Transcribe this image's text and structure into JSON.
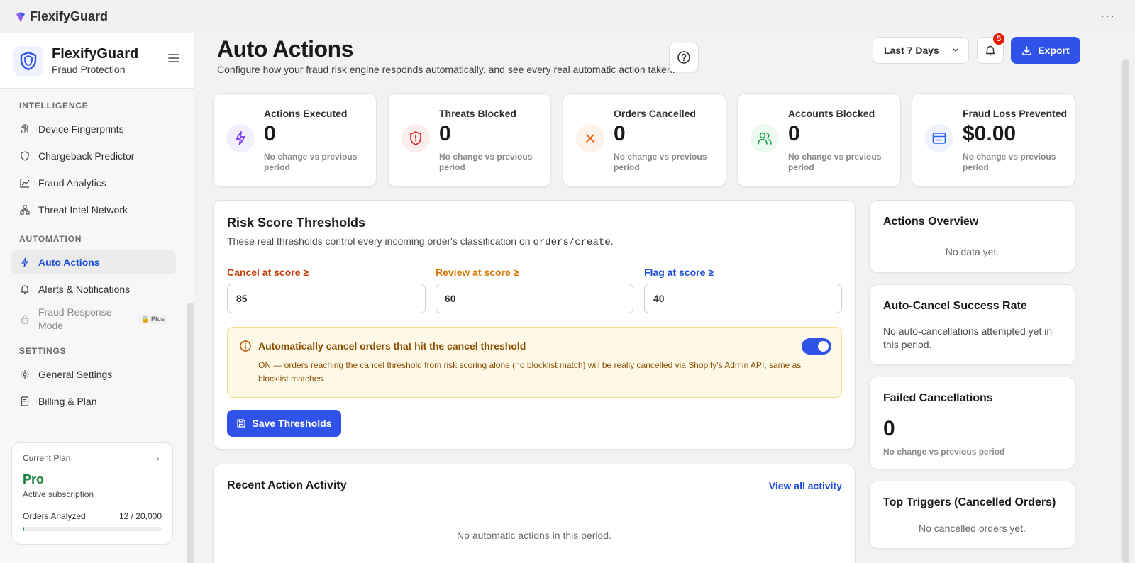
{
  "app": {
    "name": "FlexifyGuard",
    "more_label": "···"
  },
  "sidebar": {
    "brand_title": "FlexifyGuard",
    "brand_subtitle": "Fraud Protection",
    "sections": [
      {
        "title": "INTELLIGENCE",
        "items": [
          {
            "label": "Device Fingerprints",
            "icon": "fingerprint-icon"
          },
          {
            "label": "Chargeback Predictor",
            "icon": "shield-icon"
          },
          {
            "label": "Fraud Analytics",
            "icon": "chart-line-icon"
          },
          {
            "label": "Threat Intel Network",
            "icon": "network-icon"
          }
        ]
      },
      {
        "title": "AUTOMATION",
        "items": [
          {
            "label": "Auto Actions",
            "icon": "bolt-icon",
            "active": true
          },
          {
            "label": "Alerts & Notifications",
            "icon": "bell-icon"
          },
          {
            "label": "Fraud Response Mode",
            "icon": "lock-icon",
            "badge": "Plus",
            "disabled": true
          }
        ]
      },
      {
        "title": "SETTINGS",
        "items": [
          {
            "label": "General Settings",
            "icon": "gear-icon"
          },
          {
            "label": "Billing & Plan",
            "icon": "receipt-icon"
          }
        ]
      }
    ],
    "plan": {
      "label": "Current Plan",
      "name": "Pro",
      "status": "Active subscription",
      "usage_label": "Orders Analyzed",
      "usage_value": "12 / 20,000",
      "usage_fraction": 0.0006
    }
  },
  "header": {
    "title": "Auto Actions",
    "subtitle": "Configure how your fraud risk engine responds automatically, and see every real automatic action taken.",
    "range": "Last 7 Days",
    "notifications_count": "5",
    "export_label": "Export"
  },
  "stats": [
    {
      "label": "Actions Executed",
      "value": "0",
      "change": "No change vs previous period",
      "icon": "bolt-icon",
      "color": "#7c3aed",
      "bg": "#f3effd"
    },
    {
      "label": "Threats Blocked",
      "value": "0",
      "change": "No change vs previous period",
      "icon": "shield-alert-icon",
      "color": "#dc2626",
      "bg": "#fdeeee"
    },
    {
      "label": "Orders Cancelled",
      "value": "0",
      "change": "No change vs previous period",
      "icon": "x-icon",
      "color": "#ea580c",
      "bg": "#fef3ea"
    },
    {
      "label": "Accounts Blocked",
      "value": "0",
      "change": "No change vs previous period",
      "icon": "users-icon",
      "color": "#16a34a",
      "bg": "#ecfaf0"
    },
    {
      "label": "Fraud Loss Prevented",
      "value": "$0.00",
      "change": "No change vs previous period",
      "icon": "wallet-icon",
      "color": "#2563eb",
      "bg": "#eef3fe"
    }
  ],
  "thresholds": {
    "title": "Risk Score Thresholds",
    "desc_prefix": "These real thresholds control every incoming order's classification on",
    "desc_code": "orders/create",
    "desc_suffix": ".",
    "cancel_label": "Cancel at score ≥",
    "cancel_value": "85",
    "cancel_color": "#c2410c",
    "review_label": "Review at score ≥",
    "review_value": "60",
    "review_color": "#d97706",
    "flag_label": "Flag at score ≥",
    "flag_value": "40",
    "flag_color": "#1d4ed8",
    "notice_title": "Automatically cancel orders that hit the cancel threshold",
    "notice_desc": "ON — orders reaching the cancel threshold from risk scoring alone (no blocklist match) will be really cancelled via Shopify's Admin API, same as blocklist matches.",
    "auto_cancel_on": true,
    "save_label": "Save Thresholds"
  },
  "activity": {
    "title": "Recent Action Activity",
    "view_all": "View all activity",
    "empty": "No automatic actions in this period."
  },
  "overview": {
    "title": "Actions Overview",
    "empty": "No data yet."
  },
  "success_rate": {
    "title": "Auto-Cancel Success Rate",
    "empty": "No auto-cancellations attempted yet in this period."
  },
  "failed": {
    "title": "Failed Cancellations",
    "value": "0",
    "change": "No change vs previous period"
  },
  "triggers": {
    "title": "Top Triggers (Cancelled Orders)",
    "empty": "No cancelled orders yet."
  }
}
